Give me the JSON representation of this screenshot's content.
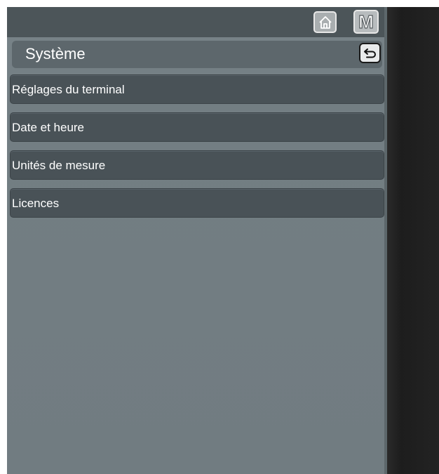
{
  "header": {
    "home_icon": "home-icon",
    "manual_icon": "m-icon",
    "manual_label": "M"
  },
  "title": {
    "text": "Système",
    "back_icon": "back-arrow-icon"
  },
  "menu": {
    "items": [
      {
        "label": "Réglages du terminal"
      },
      {
        "label": "Date et heure"
      },
      {
        "label": "Unités de mesure"
      },
      {
        "label": "Licences"
      }
    ]
  },
  "colors": {
    "panel": "#737e83",
    "menu_item": "#495257",
    "topbar": "#4c5559"
  }
}
